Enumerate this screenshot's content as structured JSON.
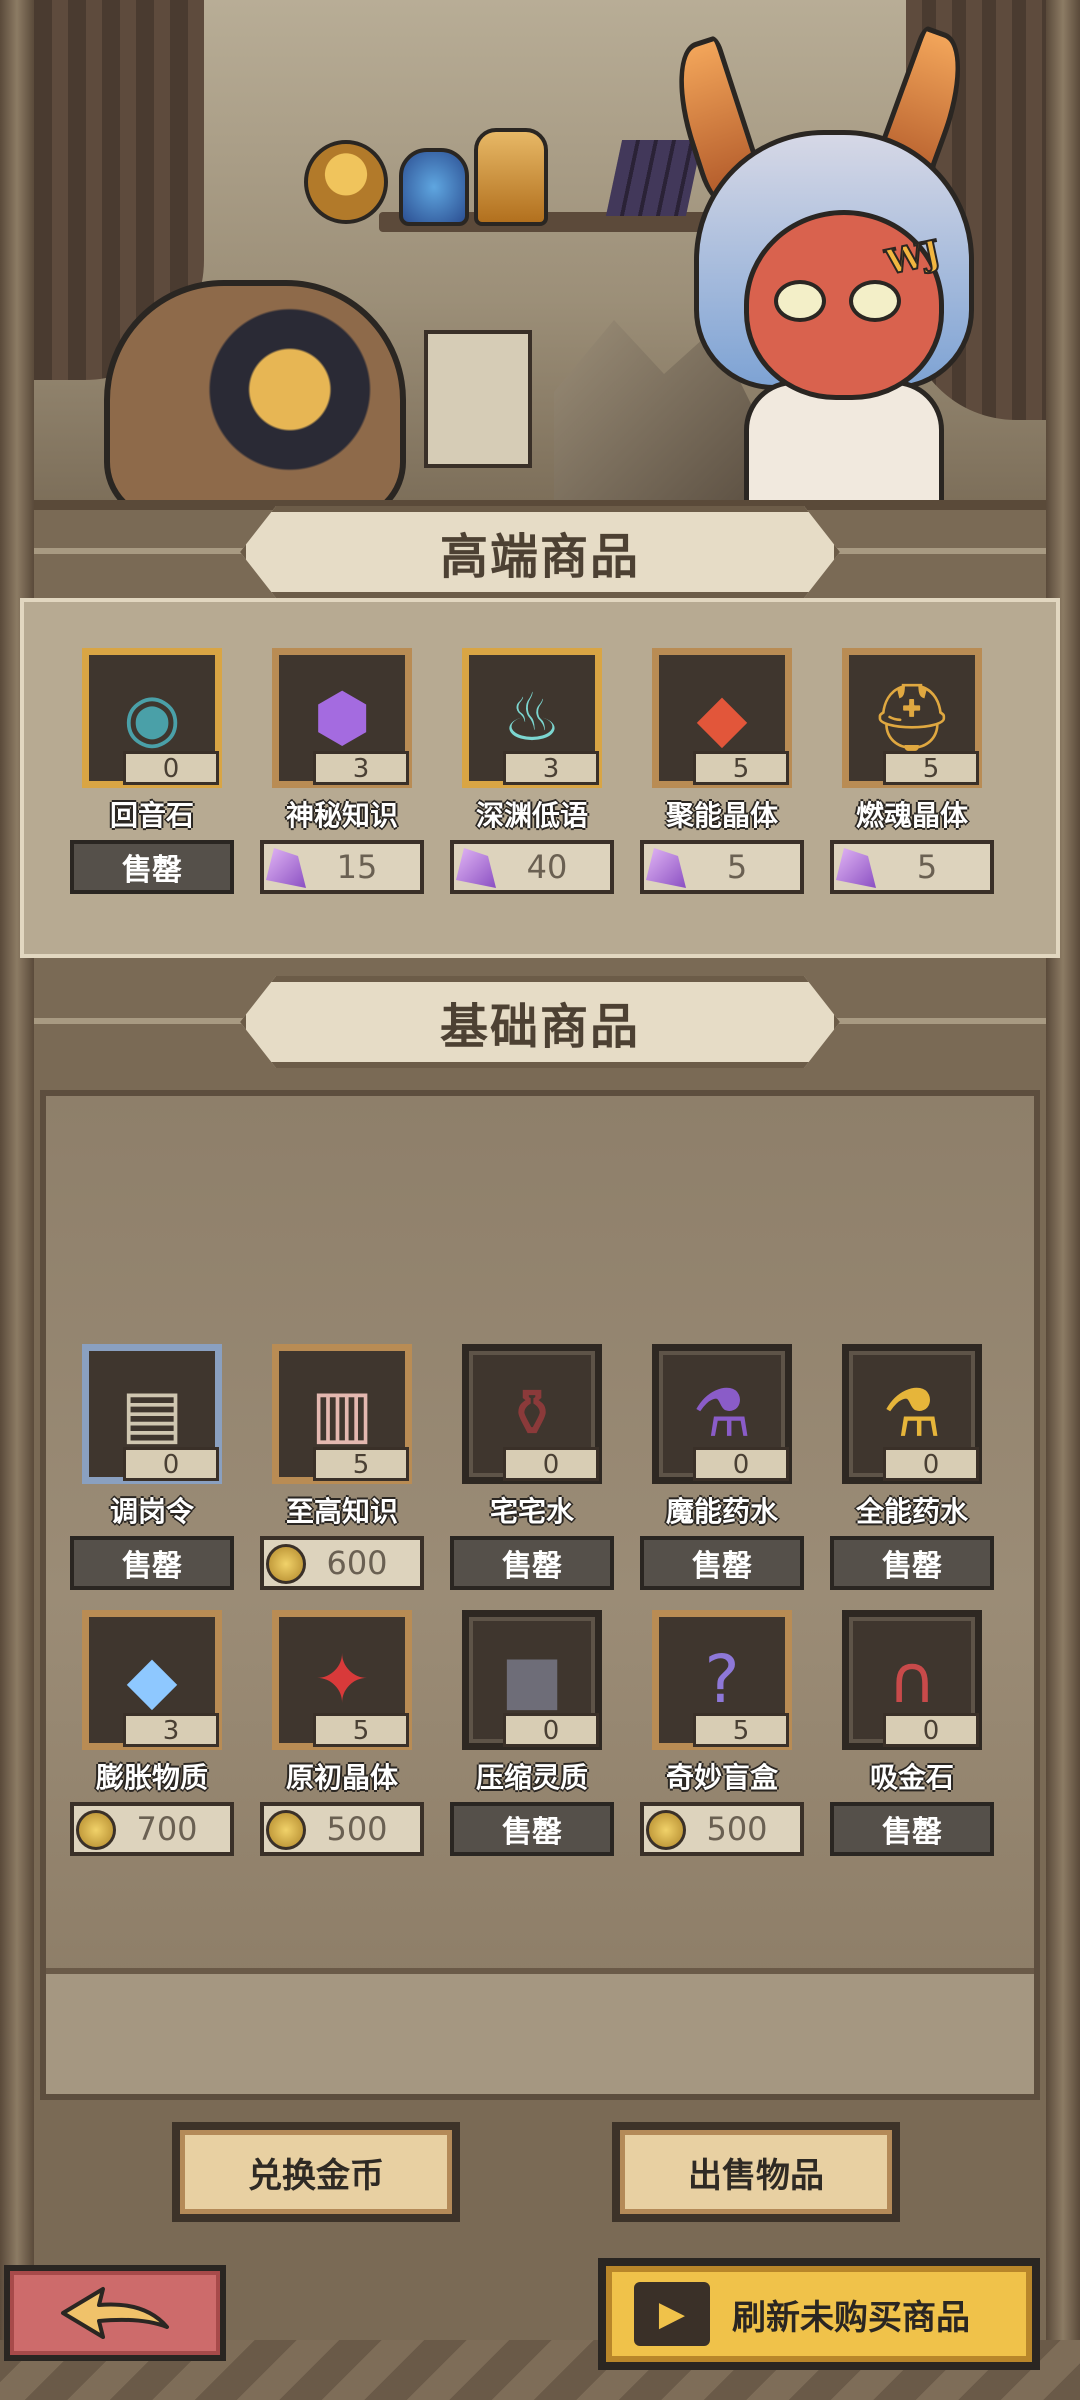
{
  "sections": {
    "premium_title": "高端商品",
    "basic_title": "基础商品"
  },
  "colors": {
    "frame": "#b98c54",
    "gold_button": "#f0c24a",
    "back_button": "#cd6b6b"
  },
  "premium_items": [
    {
      "name": "回音石",
      "count": "0",
      "state": "售罄",
      "icon": "dark-disc-icon"
    },
    {
      "name": "神秘知识",
      "count": "3",
      "price": "15",
      "currency": "crystal-icon",
      "icon": "purple-skull-gem-icon"
    },
    {
      "name": "深渊低语",
      "count": "3",
      "price": "40",
      "currency": "crystal-icon",
      "icon": "spirit-lamp-icon"
    },
    {
      "name": "聚能晶体",
      "count": "5",
      "price": "5",
      "currency": "crystal-icon",
      "icon": "red-crystal-icon"
    },
    {
      "name": "燃魂晶体",
      "count": "5",
      "price": "5",
      "currency": "crystal-icon",
      "icon": "golden-helmet-icon"
    }
  ],
  "basic_items": [
    {
      "name": "调岗令",
      "count": "0",
      "state": "售罄",
      "icon": "scroll-icon"
    },
    {
      "name": "至高知识",
      "count": "5",
      "price": "600",
      "currency": "coin-icon",
      "icon": "open-book-icon"
    },
    {
      "name": "宅宅水",
      "count": "0",
      "state": "售罄",
      "icon": "bottle-icon"
    },
    {
      "name": "魔能药水",
      "count": "0",
      "state": "售罄",
      "icon": "purple-potion-icon"
    },
    {
      "name": "全能药水",
      "count": "0",
      "state": "售罄",
      "icon": "gold-potion-icon"
    },
    {
      "name": "膨胀物质",
      "count": "3",
      "price": "700",
      "currency": "coin-icon",
      "icon": "blue-crystal-icon"
    },
    {
      "name": "原初晶体",
      "count": "5",
      "price": "500",
      "currency": "coin-icon",
      "icon": "red-crystal-cluster-icon"
    },
    {
      "name": "压缩灵质",
      "count": "0",
      "state": "售罄",
      "icon": "compressed-block-icon"
    },
    {
      "name": "奇妙盲盒",
      "count": "5",
      "price": "500",
      "currency": "coin-icon",
      "icon": "mystery-box-icon"
    },
    {
      "name": "吸金石",
      "count": "0",
      "state": "售罄",
      "icon": "magnet-icon"
    }
  ],
  "buttons": {
    "exchange_gold": "兑换金币",
    "sell_items": "出售物品",
    "refresh": "刷新未购买商品"
  }
}
